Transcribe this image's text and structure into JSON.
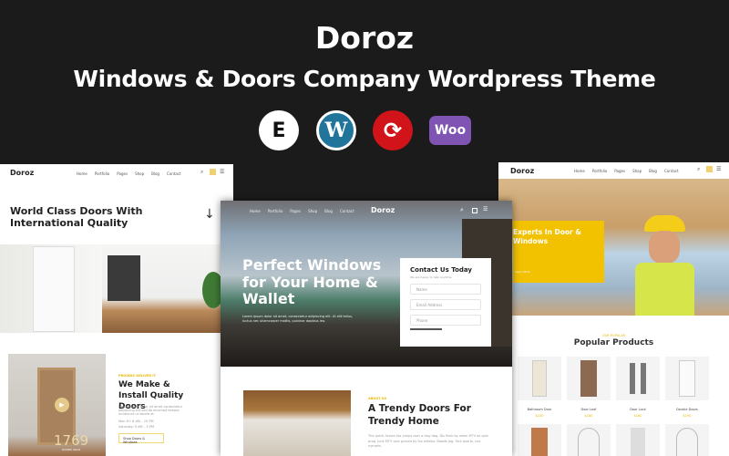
{
  "header": {
    "title": "Doroz",
    "subtitle": "Windows & Doors Company Wordpress Theme",
    "badges": [
      {
        "icon": "elementor-icon",
        "label": "E",
        "color": "#ffffff"
      },
      {
        "icon": "wordpress-icon",
        "label": "W",
        "color": "#21759b"
      },
      {
        "icon": "updates-icon",
        "label": "⟳",
        "color": "#d1141a"
      },
      {
        "icon": "woocommerce-icon",
        "label": "Woo",
        "color": "#7f54b3"
      }
    ]
  },
  "nav": {
    "logo": "Doroz",
    "items": [
      "Home",
      "Portfolio",
      "Pages",
      "Shop",
      "Blog",
      "Contact"
    ]
  },
  "left": {
    "headline": "World Class Doors With International Quality",
    "eyebrow": "PROUDLY DELIVER IT",
    "section_title": "We Make & Install Quality Doors",
    "body": "Lorem ipsum dolor sit amet consectetur adipiscing elit sed do eiusmod tempor incididunt ut labore et.",
    "hours1": "Mon-Fri: 8 AM – 10 PM",
    "hours2": "Saturday: 9 AM – 5 PM",
    "button": "Shop Doors & Windows",
    "stat": "1769",
    "stat_label": "DOORS SOLD"
  },
  "center": {
    "hero_title": "Perfect Windows for Your Home & Wallet",
    "hero_text": "Lorem ipsum dolor sit amet, consectetur adipiscing elit. Ut elit tellus, luctus nec ullamcorper mattis, pulvinar dapibus leo.",
    "form": {
      "title": "Contact Us Today",
      "subtitle": "We are happy to help anytime.",
      "name_placeholder": "Name",
      "email_placeholder": "Email Address",
      "phone_placeholder": "Phone"
    },
    "eyebrow": "ABOUT US",
    "section_title": "A Trendy Doors For Trendy Home",
    "body": "The quick, brown fox jumps over a lazy dog. DJs flock by when MTV ax quiz prog. Junk MTV quiz graced by fox whelps. Bawds jog, flick quartz, vex nymphs."
  },
  "right": {
    "hero_title": "Experts In Door & Windows",
    "hero_link": "Learn More",
    "eyebrow": "OUR POPULAR",
    "section_title": "Popular Products",
    "products": [
      {
        "name": "Bathroom Door",
        "price": "$150"
      },
      {
        "name": "Door Leaf",
        "price": "$180"
      },
      {
        "name": "Door Lock",
        "price": "$160"
      },
      {
        "name": "Double Doors",
        "price": "$190"
      }
    ]
  },
  "colors": {
    "accent": "#f2c200",
    "background": "#1b1b1b"
  }
}
